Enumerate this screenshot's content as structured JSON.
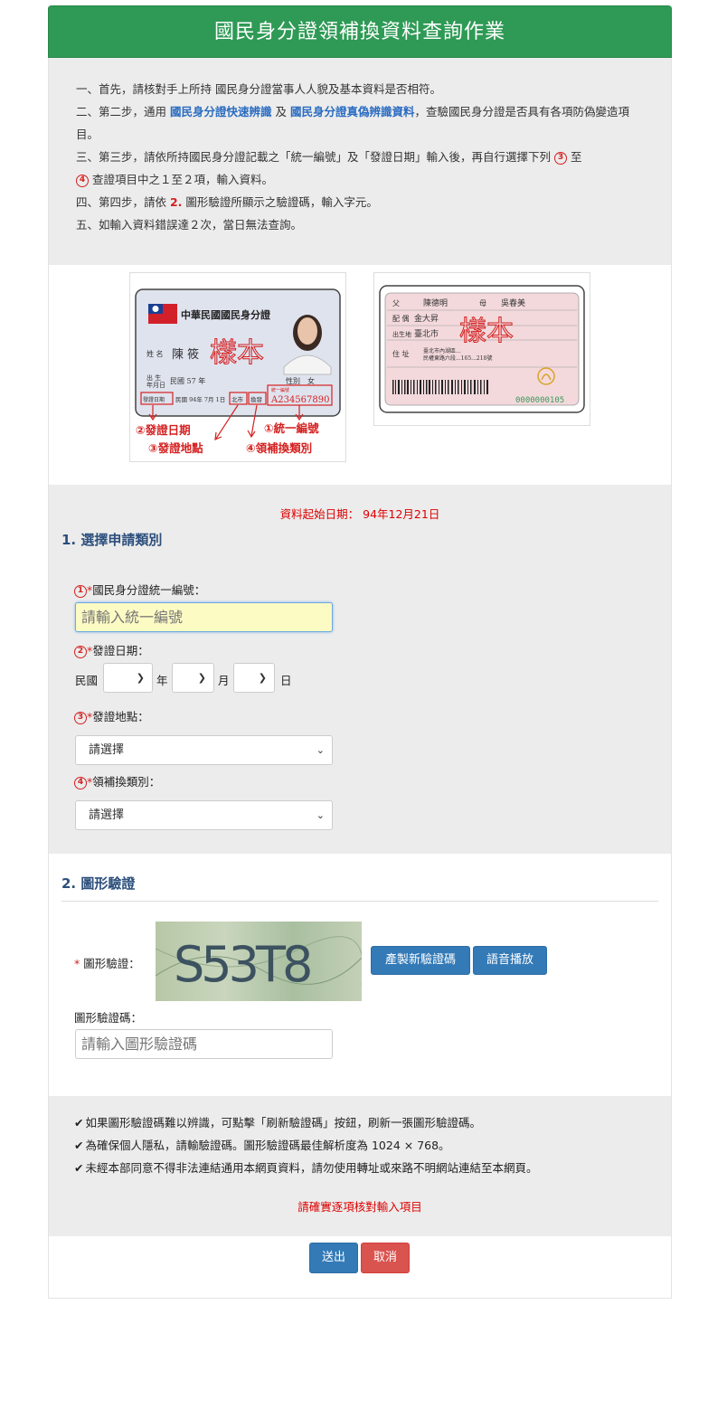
{
  "header": {
    "title": "國民身分證領補換資料查詢作業"
  },
  "intro": {
    "step1": "一、首先，請核對手上所持 國民身分證當事人人貌及基本資料是否相符。",
    "step2_a": "二、第二步，通用 ",
    "step2_link1": "國民身分證快速辨識",
    "step2_b": " 及 ",
    "step2_link2": "國民身分證真偽辨識資料",
    "step2_c": "，查驗國民身分證是否具有各項防偽變造項目。",
    "step3_a": "三、第三步，請依所持國民身分證記載之「統一編號」及「發證日期」輸入後，再自行選擇下列 ",
    "step3_b": " 至",
    "step3_c": " 查證項目中之１至２項，輸入資料。",
    "step4_a": "四、第四步，請依 ",
    "step4_num": "2.",
    "step4_b": " 圖形驗證所顯示之驗證碼，輸入字元。",
    "step5": "五、如輸入資料錯誤達２次，當日無法查詢。",
    "circle3": "3",
    "circle4": "4"
  },
  "sample_front": {
    "country": "中華民國國民身分證",
    "name_label": "姓 名",
    "name_value": "陳 筱",
    "birth_label": "出 生\n年月日",
    "birth_value": "民國 57 年",
    "sex_label": "性別",
    "sex_value": "女",
    "issue_label": "發證日期",
    "issue_value": "民國 94年 7月 1日",
    "place_value": "北市",
    "type_value": "換發",
    "id_label": "統一編號",
    "id_value": "A234567890",
    "watermark": "樣本",
    "annot1": "①統一編號",
    "annot2": "②發證日期",
    "annot3": "③發證地點",
    "annot4": "④領補換類別"
  },
  "sample_back": {
    "father_label": "父",
    "father_value": "陳德明",
    "mother_label": "母",
    "mother_value": "吳春美",
    "spouse_label": "配 偶",
    "spouse_value": "金大昇",
    "birthplace_label": "出生地",
    "birthplace_value": "臺北市",
    "address_label": "住 址",
    "address_line1": "臺北市內湖區...",
    "address_line2": "民權東路六段...165...218號",
    "serial": "0000000105",
    "watermark": "樣本"
  },
  "form1": {
    "start_date": "資料起始日期： 94年12月21日",
    "section_title": "1. 選擇申請類別",
    "id_label": "國民身分證統一編號：",
    "id_placeholder": "請輸入統一編號",
    "date_label": "發證日期：",
    "roc": "民國",
    "year": "年",
    "month": "月",
    "day": "日",
    "place_label": "發證地點：",
    "place_select": "請選擇",
    "type_label": "領補換類別：",
    "type_select": "請選擇",
    "c1": "1",
    "c2": "2",
    "c3": "3",
    "c4": "4",
    "star": "*"
  },
  "form2": {
    "section_title": "2. 圖形驗證",
    "captcha_label": "圖形驗證：",
    "captcha_text": "S53T8",
    "refresh_button": "產製新驗證碼",
    "audio_button": "語音播放",
    "code_label": "圖形驗證碼：",
    "code_placeholder": "請輸入圖形驗證碼",
    "star": "*"
  },
  "notes": {
    "n1": "如果圖形驗證碼難以辨識，可點擊「刷新驗證碼」按鈕，刷新一張圖形驗證碼。",
    "n2": "為確保個人隱私，請輸驗證碼。圖形驗證碼最佳解析度為 1024 × 768。",
    "n3": "未經本部同意不得非法連結通用本網頁資料，請勿使用轉址或來路不明網站連結至本網頁。",
    "confirm": "請確實逐項核對輸入項目",
    "check": "✔"
  },
  "actions": {
    "submit": "送出",
    "cancel": "取消"
  }
}
